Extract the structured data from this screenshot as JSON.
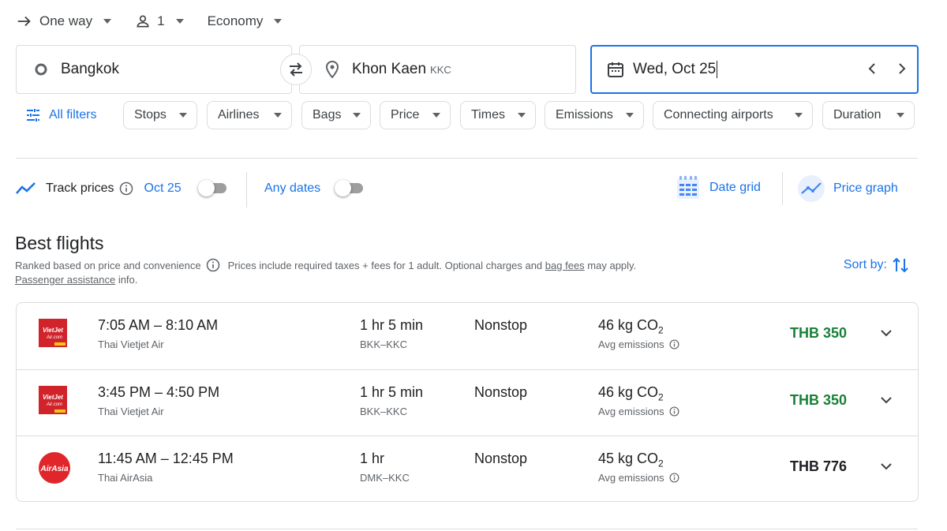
{
  "trip": {
    "type_label": "One way",
    "passengers": "1",
    "cabin": "Economy"
  },
  "search": {
    "origin": "Bangkok",
    "destination": "Khon Kaen",
    "destination_code": "KKC",
    "date": "Wed, Oct 25"
  },
  "filters": {
    "all_filters": "All filters",
    "chips": [
      "Stops",
      "Airlines",
      "Bags",
      "Price",
      "Times",
      "Emissions",
      "Connecting airports",
      "Duration"
    ]
  },
  "tracking": {
    "label": "Track prices",
    "date": "Oct 25",
    "any_dates": "Any dates",
    "date_grid": "Date grid",
    "price_graph": "Price graph"
  },
  "section": {
    "title": "Best flights",
    "ranked": "Ranked based on price and convenience",
    "prices_note_a": "Prices include required taxes + fees for 1 adult. Optional charges and",
    "bag_fees": "bag fees",
    "prices_note_b": "may apply.",
    "passenger_assistance": "Passenger assistance",
    "info": "info.",
    "sort_label": "Sort by:"
  },
  "flights": [
    {
      "times": "7:05 AM – 8:10 AM",
      "airline": "Thai Vietjet Air",
      "duration": "1 hr 5 min",
      "route": "BKK–KKC",
      "stops": "Nonstop",
      "co2": "46 kg CO",
      "co2_sub": "2",
      "emissions": "Avg emissions",
      "price": "THB 350",
      "price_color": "#188038"
    },
    {
      "times": "3:45 PM – 4:50 PM",
      "airline": "Thai Vietjet Air",
      "duration": "1 hr 5 min",
      "route": "BKK–KKC",
      "stops": "Nonstop",
      "co2": "46 kg CO",
      "co2_sub": "2",
      "emissions": "Avg emissions",
      "price": "THB 350",
      "price_color": "#188038"
    },
    {
      "times": "11:45 AM – 12:45 PM",
      "airline": "Thai AirAsia",
      "duration": "1 hr",
      "route": "DMK–KKC",
      "stops": "Nonstop",
      "co2": "45 kg CO",
      "co2_sub": "2",
      "emissions": "Avg emissions",
      "price": "THB 776",
      "price_color": "#202124"
    }
  ],
  "colors": {
    "accent": "#1a73e8",
    "price_low": "#188038",
    "vietjet_red": "#d0232a",
    "airasia_red": "#e0262b"
  }
}
